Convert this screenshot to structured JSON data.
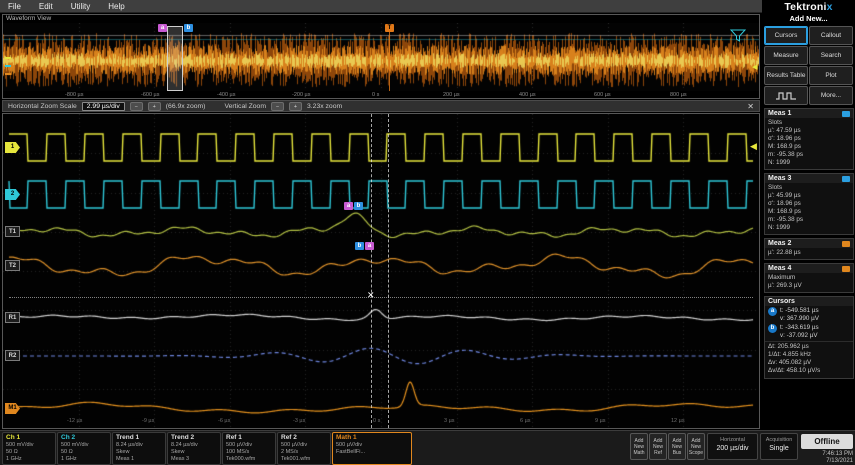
{
  "menu": {
    "items": [
      "File",
      "Edit",
      "Utility",
      "Help"
    ]
  },
  "brand": {
    "logo": "Tektronix",
    "add_new_label": "Add New..."
  },
  "sidebar": {
    "buttons": {
      "cursors": "Cursors",
      "callout": "Callout",
      "measure": "Measure",
      "search": "Search",
      "results_table": "Results Table",
      "plot": "Plot",
      "more": "More..."
    },
    "meas1": {
      "title": "Meas 1",
      "lines": [
        "Slots",
        "µ': 47.59 µs",
        "σ': 18.96 ps",
        "M: 168.9 ps",
        "m: -95.38 ps",
        "N: 1999"
      ]
    },
    "meas3": {
      "title": "Meas 3",
      "lines": [
        "Slots",
        "µ': 45.99 µs",
        "σ': 18.96 ps",
        "M: 168.9 ps",
        "m: -95.38 ps",
        "N: 1999"
      ]
    },
    "meas2": {
      "title": "Meas 2",
      "lines": [
        "µ': 22.88 µs"
      ]
    },
    "meas4": {
      "title": "Meas 4",
      "lines": [
        "Maximum",
        "µ': 269.3 µV"
      ]
    },
    "cursors": {
      "title": "Cursors",
      "a_label": "a",
      "b_label": "b",
      "a1": "t: -549.581 µs",
      "a2": "v: 367.990 µV",
      "b1": "t: -343.619 µs",
      "b2": "v: -37.092 µV",
      "s1": "Δt: 205.962 µs",
      "s2": "1/Δt: 4.855 kHz",
      "s3": "Δv: 405.082 µV",
      "s4": "Δv/Δt: 458.10 µV/s"
    }
  },
  "overview": {
    "title": "Waveform View",
    "time_labels": [
      "-800 µs",
      "-600 µs",
      "-400 µs",
      "-200 µs",
      "0 s",
      "200 µs",
      "400 µs",
      "600 µs",
      "800 µs"
    ],
    "marker_a": "a",
    "marker_b": "b",
    "trigger": "T"
  },
  "zoombar": {
    "h_label": "Horizontal Zoom Scale",
    "h_value": "2.99 µs/div",
    "h_factor": "(66.9x zoom)",
    "v_label": "Vertical Zoom",
    "v_factor": "3.23x zoom",
    "minus": "−",
    "plus": "+",
    "close": "✕"
  },
  "grid": {
    "badges": [
      "1",
      "2",
      "T1",
      "T2",
      "R1",
      "R2",
      "M1"
    ],
    "time_labels": [
      "-12 µs",
      "-9 µs",
      "-6 µs",
      "-3 µs",
      "0 s",
      "3 µs",
      "6 µs",
      "9 µs",
      "12 µs"
    ],
    "marker_a": "a",
    "marker_b": "b",
    "cross": "✕",
    "trig_level": "◀"
  },
  "channels": [
    {
      "name": "Ch 1",
      "l1": "500 mV/div",
      "l2": "50 Ω",
      "l3": "1 GHz"
    },
    {
      "name": "Ch 2",
      "l1": "500 mV/div",
      "l2": "50 Ω",
      "l3": "1 GHz"
    },
    {
      "name": "Trend 1",
      "l1": "8.24 µs/div",
      "l2": "Skew",
      "l3": "Meas 1"
    },
    {
      "name": "Trend 2",
      "l1": "8.24 µs/div",
      "l2": "Skew",
      "l3": "Meas 3"
    },
    {
      "name": "Ref 1",
      "l1": "500 µV/div",
      "l2": "100 MS/s",
      "l3": "Tek000.wfm"
    },
    {
      "name": "Ref 2",
      "l1": "500 µV/div",
      "l2": "2 MS/s",
      "l3": "Tek001.wfm"
    },
    {
      "name": "Math 1",
      "l1": "500 µV/div",
      "l2": "FastBellFi...",
      "l3": ""
    }
  ],
  "bottom": {
    "add_buttons": [
      {
        "l1": "Add",
        "l2": "New",
        "l3": "Math"
      },
      {
        "l1": "Add",
        "l2": "New",
        "l3": "Ref"
      },
      {
        "l1": "Add",
        "l2": "New",
        "l3": "Bus"
      },
      {
        "l1": "Add",
        "l2": "New",
        "l3": "Scope"
      }
    ],
    "horizontal": {
      "title": "Horizontal",
      "value": "200 µs/div"
    },
    "acquisition": {
      "title": "Acquisition",
      "value": "Single"
    },
    "offline": "Offline",
    "time": "7:46:13 PM",
    "date": "7/13/2021"
  },
  "colors": {
    "ch1": "#e6e63c",
    "ch2": "#2fc8d8",
    "trend1": "#b4c244",
    "trend2": "#e0922a",
    "ref1": "#d4d4d4",
    "ref2": "#6e86e0",
    "math1": "#e6921e",
    "accent_blue": "#2b9fe0",
    "marker_a": "#c85ad2",
    "marker_b": "#2e8fe0",
    "trigger_orange": "#e07818"
  }
}
